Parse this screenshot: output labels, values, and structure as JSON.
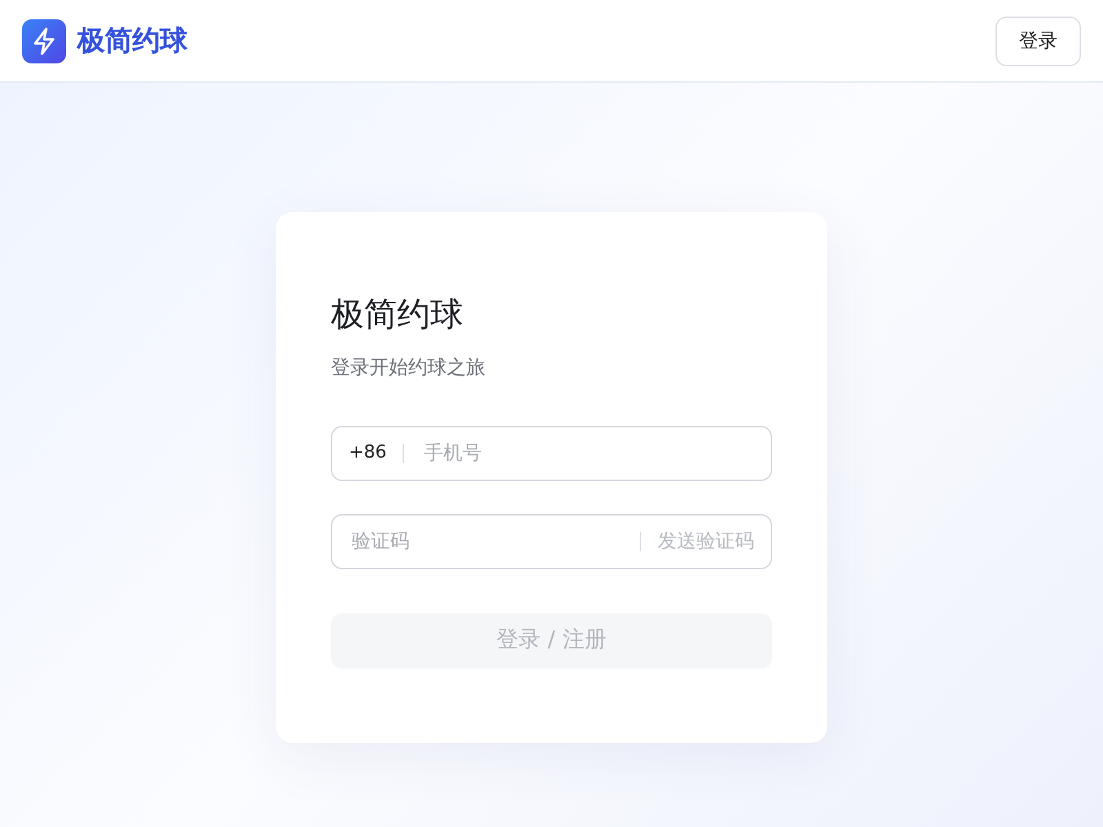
{
  "header": {
    "brand": "极简约球",
    "login_button": "登录"
  },
  "card": {
    "title": "极简约球",
    "subtitle": "登录开始约球之旅",
    "phone": {
      "prefix": "+86",
      "placeholder": "手机号"
    },
    "code": {
      "placeholder": "验证码",
      "send_button": "发送验证码",
      "send_disabled": true
    },
    "submit": {
      "label": "登录 / 注册",
      "disabled": true
    }
  }
}
